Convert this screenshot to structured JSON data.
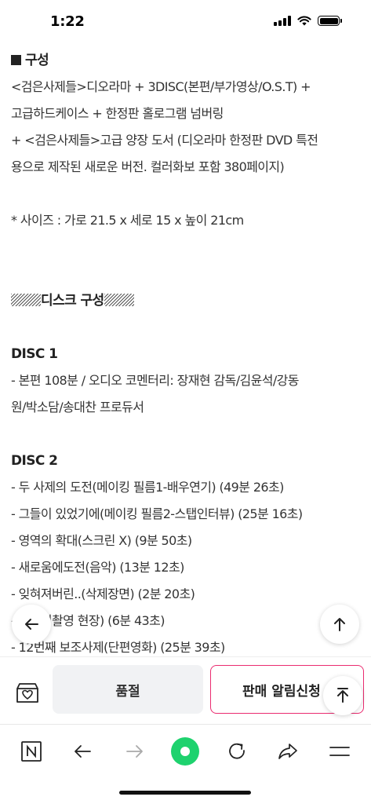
{
  "status_bar": {
    "time": "1:22"
  },
  "content": {
    "composition_heading": "구성",
    "composition_lines": [
      "<검은사제들>디오라마 + 3DISC(본편/부가영상/O.S.T) +",
      "고급하드케이스 + 한정판 홀로그램 넘버링",
      "+ <검은사제들>고급 양장 도서 (디오라마 한정판 DVD 특전",
      "용으로 제작된 새로운 버전. 컬러화보 포함 380페이지)"
    ],
    "size_line": "* 사이즈 : 가로 21.5 x 세로 15 x 높이 21cm",
    "disc_section_title": "디스크 구성",
    "disc1": {
      "title": "DISC 1",
      "lines": [
        "- 본편 108분 / 오디오 코멘터리: 장재현 감독/김윤석/강동",
        "원/박소담/송대찬 프로듀서"
      ]
    },
    "disc2": {
      "title": "DISC 2",
      "lines": [
        "- 두 사제의 도전(메이킹 필름1-배우연기) (49분 26초)",
        "- 그들이 있었기에(메이킹 필름2-스탭인터뷰) (25분 16초)",
        "- 영역의 확대(스크린 X) (9분 50초)",
        "- 새로움에도전(음악) (13분 12초)",
        "- 잊혀져버린..(삭제장면) (2분 20초)",
        "- 포스터촬영 현장) (6분 43초)",
        "- 12번째 보조사제(단편영화) (25분 39초)"
      ]
    }
  },
  "action_bar": {
    "soldout_label": "품절",
    "alert_label": "판매 알림신청",
    "accent_color": "#ea2c70"
  },
  "icons": {
    "back_float": "arrow-left-icon",
    "top_float": "arrow-up-icon",
    "top_float_2": "arrow-up-icon",
    "heart_box": "heart-box-icon",
    "naver": "naver-n-icon",
    "back": "back-arrow-icon",
    "forward": "forward-arrow-icon",
    "green_dot": "green-dot-icon",
    "reload": "reload-icon",
    "share": "share-icon",
    "menu": "menu-icon"
  },
  "colors": {
    "green_dot": "#1ed26e"
  }
}
